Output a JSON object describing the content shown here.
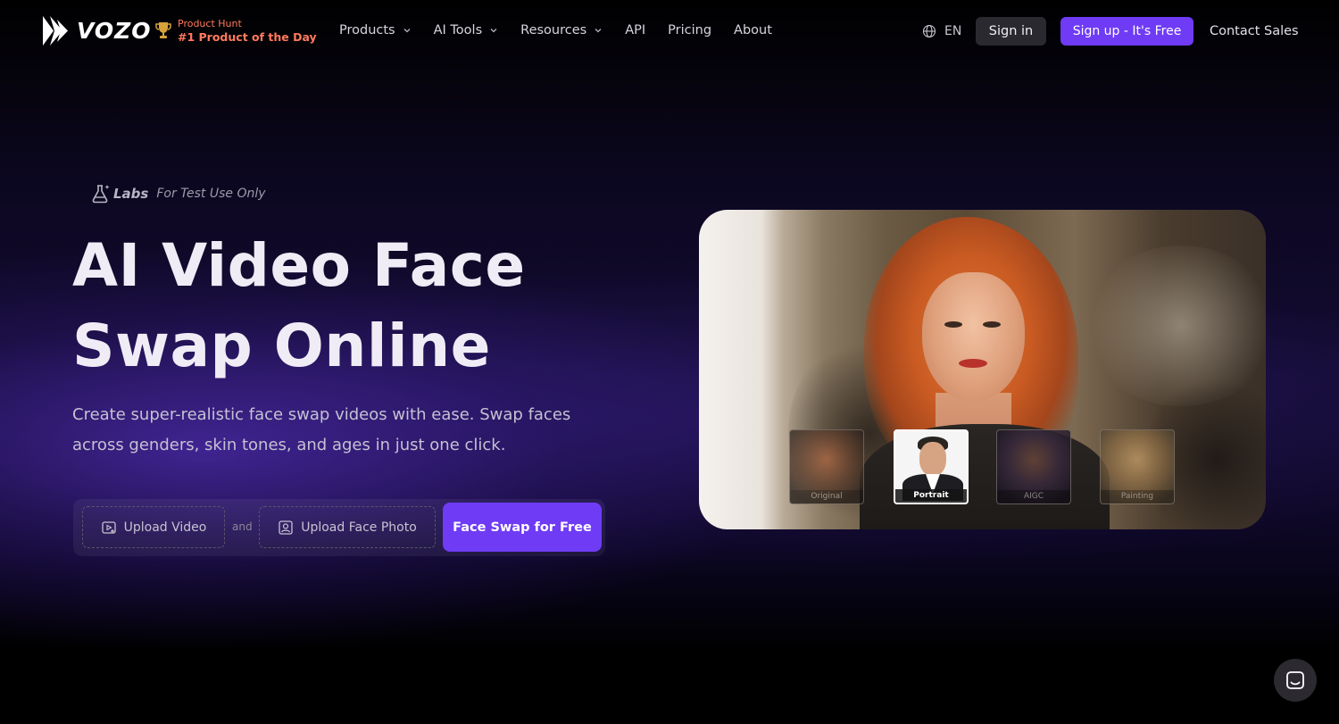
{
  "brand": {
    "name": "VOZO"
  },
  "product_hunt": {
    "line1": "Product Hunt",
    "line2": "#1 Product of the Day"
  },
  "nav": {
    "items": [
      {
        "label": "Products",
        "has_dropdown": true
      },
      {
        "label": "AI Tools",
        "has_dropdown": true
      },
      {
        "label": "Resources",
        "has_dropdown": true
      },
      {
        "label": "API",
        "has_dropdown": false
      },
      {
        "label": "Pricing",
        "has_dropdown": false
      },
      {
        "label": "About",
        "has_dropdown": false
      }
    ],
    "language": "EN",
    "sign_in": "Sign in",
    "sign_up": "Sign up - It's Free",
    "contact_sales": "Contact Sales"
  },
  "hero": {
    "labs_label": "Labs",
    "labs_note": "For Test Use Only",
    "title_line1": "AI Video Face",
    "title_line2": "Swap Online",
    "description": "Create super-realistic face swap videos with ease. Swap faces across genders, skin tones, and ages in just one click.",
    "upload_video": "Upload Video",
    "and_text": "and",
    "upload_face": "Upload Face Photo",
    "cta": "Face Swap for Free"
  },
  "preview": {
    "thumbnails": [
      {
        "caption": "Original"
      },
      {
        "caption": "Portrait"
      },
      {
        "caption": "AIGC"
      },
      {
        "caption": "Painting"
      }
    ],
    "selected": "Portrait"
  },
  "colors": {
    "accent": "#6f3bf5",
    "product_hunt": "#ff7a5c",
    "background": "#000000"
  },
  "icons": [
    "vozo-logo-icon",
    "trophy-icon",
    "chevron-down-icon",
    "globe-icon",
    "flask-icon",
    "video-upload-icon",
    "face-upload-icon",
    "chat-icon"
  ]
}
